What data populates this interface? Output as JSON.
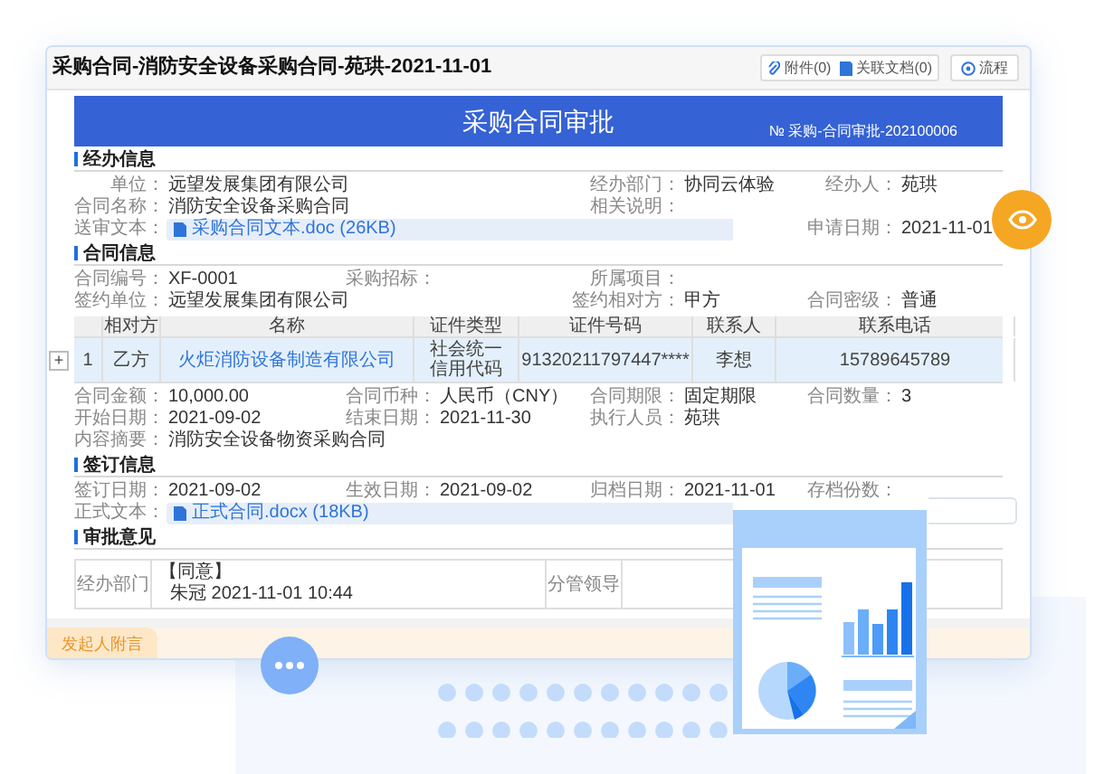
{
  "window": {
    "title": "采购合同-消防安全设备采购合同-苑珙-2021-11-01",
    "toolbar": [
      "附件(0)",
      "关联文档(0)",
      "流程"
    ]
  },
  "header": {
    "title": "采购合同审批",
    "number": "№  采购-合同审批-202100006"
  },
  "sections": [
    {
      "title": "经办信息",
      "rows": [
        [
          {
            "kind": "text",
            "label": "单位：",
            "value": "远望发展集团有限公司"
          },
          "",
          {
            "kind": "text",
            "label": "经办部门：",
            "value": "协同云体验"
          },
          {
            "kind": "text",
            "label": "经办人：",
            "value": "苑珙"
          }
        ],
        [
          {
            "kind": "text",
            "label": "合同名称：",
            "value": "消防安全设备采购合同"
          },
          "",
          {
            "kind": "text",
            "label": "相关说明："
          }
        ],
        [
          {
            "kind": "file",
            "label": "送审文本：",
            "value": "采购合同文本.doc (26KB)"
          },
          "",
          "",
          {
            "kind": "text",
            "label": "申请日期：",
            "value": "2021-11-01"
          }
        ]
      ]
    },
    {
      "title": "合同信息",
      "rows": [
        [
          {
            "kind": "text",
            "label": "合同编号：",
            "value": "XF-0001"
          },
          {
            "kind": "text",
            "label": "采购招标："
          },
          {
            "kind": "text",
            "label": "所属项目："
          }
        ],
        [
          {
            "kind": "text",
            "label": "签约单位：",
            "value": "远望发展集团有限公司"
          },
          "",
          {
            "kind": "text",
            "label": "签约相对方：",
            "value": "甲方"
          },
          {
            "kind": "text",
            "label": "合同密级：",
            "value": "普通"
          }
        ]
      ],
      "table": {
        "columns": [
          "",
          "相对方",
          "名称",
          "证件类型",
          "证件号码",
          "联系人",
          "联系电话"
        ],
        "rows": [
          {
            "expand": "+",
            "selected": true,
            "cells": [
              "1",
              "乙方",
              "火炬消防设备制造有限公司",
              "社会统一信用代码",
              "91320211797447****",
              "李想",
              "15789645789"
            ]
          }
        ]
      },
      "rows_after": [
        [
          {
            "kind": "text",
            "label": "合同金额：",
            "value": "10,000.00"
          },
          {
            "kind": "text",
            "label": "合同币种：",
            "value": "人民币（CNY）"
          },
          {
            "kind": "text",
            "label": "合同期限：",
            "value": "固定期限"
          },
          {
            "kind": "text",
            "label": "合同数量：",
            "value": "3"
          }
        ],
        [
          {
            "kind": "text",
            "label": "开始日期：",
            "value": "2021-09-02"
          },
          {
            "kind": "text",
            "label": "结束日期：",
            "value": "2021-11-30"
          },
          {
            "kind": "text",
            "label": "执行人员：",
            "value": "苑珙"
          }
        ],
        [
          {
            "kind": "text",
            "label": "内容摘要：",
            "value": "消防安全设备物资采购合同"
          }
        ]
      ]
    },
    {
      "title": "签订信息",
      "rows": [
        [
          {
            "kind": "text",
            "label": "签订日期：",
            "value": "2021-09-02"
          },
          {
            "kind": "text",
            "label": "生效日期：",
            "value": "2021-09-02"
          },
          {
            "kind": "text",
            "label": "归档日期：",
            "value": "2021-11-01"
          },
          {
            "kind": "text",
            "label": "存档份数："
          }
        ],
        [
          {
            "kind": "file",
            "label": "正式文本：",
            "value": "正式合同.docx (18KB)"
          },
          "",
          "",
          {
            "kind": "input"
          }
        ]
      ]
    },
    {
      "title": "审批意见",
      "approval": {
        "department": "经办部门",
        "verdict": "【同意】",
        "signer": "朱冠 2021-11-01 10:44",
        "leader": "分管领导"
      }
    }
  ],
  "footer_tab": {
    "label": "发起人附言",
    "selected": true
  }
}
